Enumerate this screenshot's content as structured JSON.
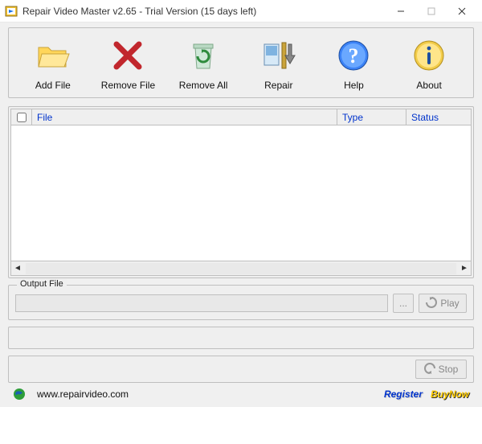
{
  "window": {
    "title": "Repair Video Master v2.65 - Trial Version (15 days left)"
  },
  "toolbar": {
    "add_file": "Add File",
    "remove_file": "Remove File",
    "remove_all": "Remove All",
    "repair": "Repair",
    "help": "Help",
    "about": "About"
  },
  "grid": {
    "col_file": "File",
    "col_type": "Type",
    "col_status": "Status"
  },
  "output": {
    "group_label": "Output File",
    "browse_label": "...",
    "play_label": "Play"
  },
  "stop": {
    "label": "Stop"
  },
  "footer": {
    "url": "www.repairvideo.com",
    "register": "Register",
    "buynow": "BuyNow"
  }
}
